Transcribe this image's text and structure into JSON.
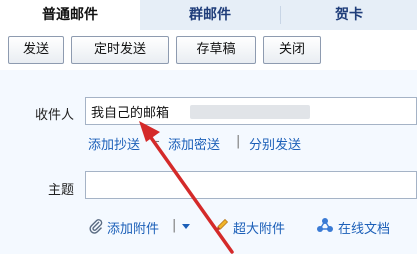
{
  "tabs": [
    {
      "label": "普通邮件",
      "active": true
    },
    {
      "label": "群邮件",
      "active": false
    },
    {
      "label": "贺卡",
      "active": false
    }
  ],
  "toolbar": {
    "send": "发送",
    "scheduled_send": "定时发送",
    "save_draft": "存草稿",
    "close": "关闭"
  },
  "recipient": {
    "label": "收件人",
    "value": "我自己的邮箱"
  },
  "recipient_links": {
    "add_cc": "添加抄送",
    "dash": "-",
    "add_bcc": "添加密送",
    "pipe": "|",
    "separate_send": "分别发送"
  },
  "subject": {
    "label": "主题",
    "value": ""
  },
  "attachments": {
    "add_attachment": "添加附件",
    "pipe": "|",
    "large_attachment": "超大附件",
    "online_doc": "在线文档"
  },
  "colors": {
    "tab_bar": "#e6eef7",
    "link": "#1b5fb8",
    "annotation_arrow": "#d42a2a"
  },
  "icons": [
    "paperclip-icon",
    "chevron-down-icon",
    "pencil-icon",
    "cloud-doc-icon",
    "red-arrow-icon"
  ]
}
